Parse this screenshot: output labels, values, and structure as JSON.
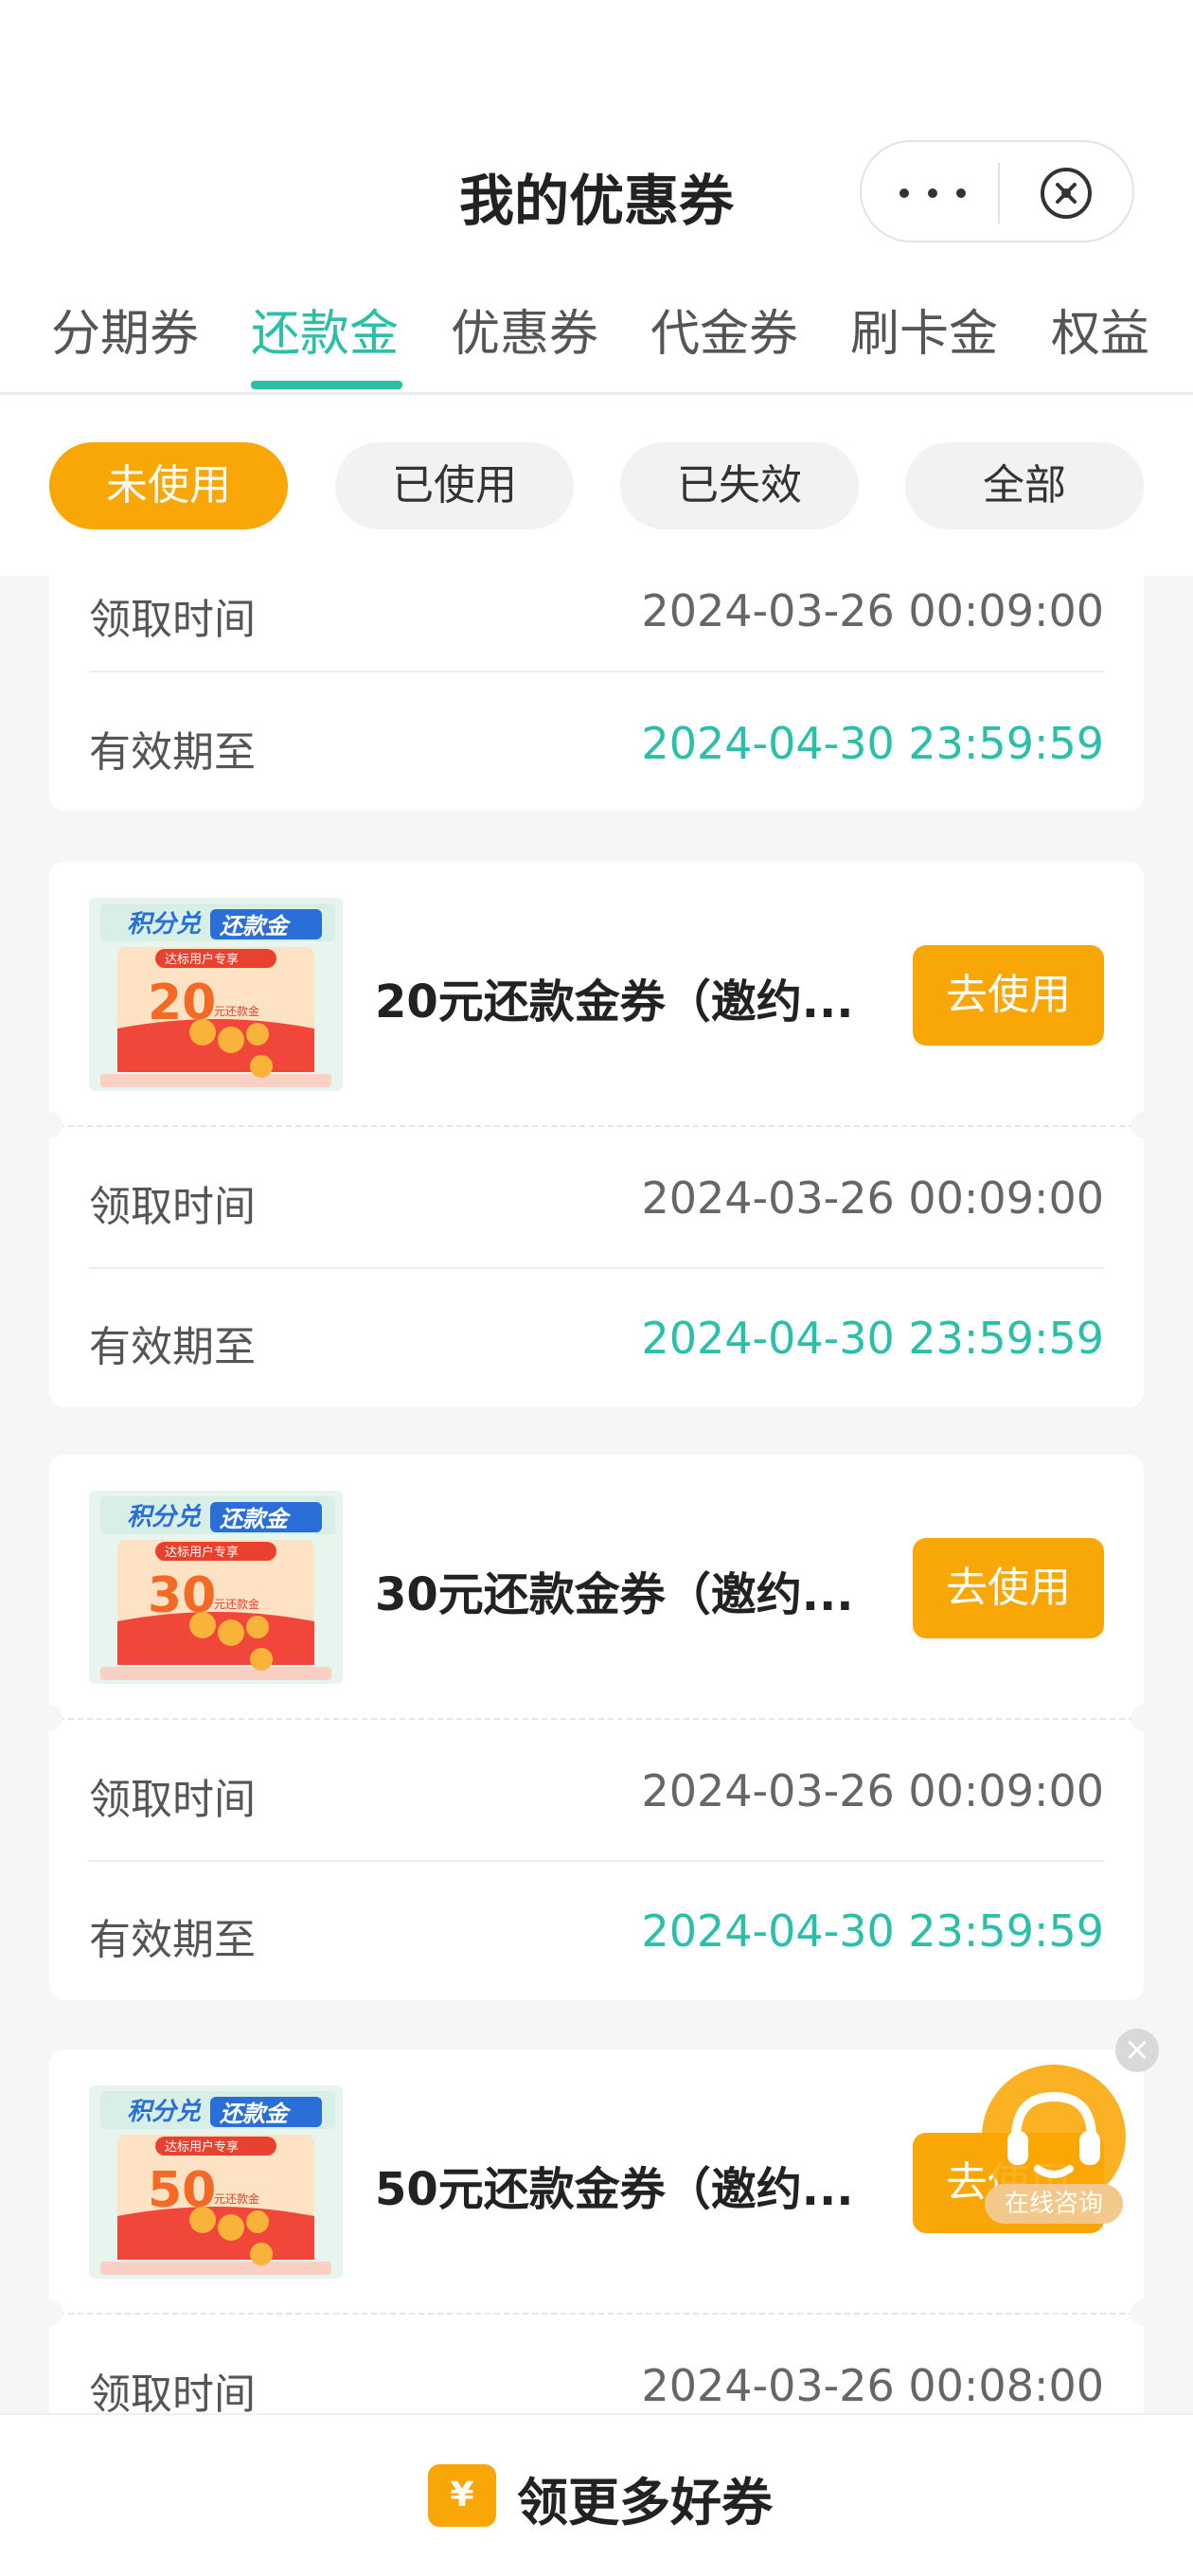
{
  "header": {
    "title": "我的优惠券"
  },
  "tabs": [
    {
      "label": "分期券",
      "active": false
    },
    {
      "label": "还款金",
      "active": true
    },
    {
      "label": "优惠券",
      "active": false
    },
    {
      "label": "代金券",
      "active": false
    },
    {
      "label": "刷卡金",
      "active": false
    },
    {
      "label": "权益",
      "active": false
    }
  ],
  "filters": [
    {
      "label": "未使用",
      "active": true
    },
    {
      "label": "已使用",
      "active": false
    },
    {
      "label": "已失效",
      "active": false
    },
    {
      "label": "全部",
      "active": false
    }
  ],
  "labels": {
    "received": "领取时间",
    "expires": "有效期至",
    "use_button": "去使用"
  },
  "coupons": [
    {
      "name": "",
      "received": "2024-03-26 00:09:00",
      "expires": "2024-04-30 23:59:59"
    },
    {
      "name": "20元还款金券（邀约...",
      "amount": "20",
      "received": "2024-03-26 00:09:00",
      "expires": "2024-04-30 23:59:59"
    },
    {
      "name": "30元还款金券（邀约...",
      "amount": "30",
      "received": "2024-03-26 00:09:00",
      "expires": "2024-04-30 23:59:59"
    },
    {
      "name": "50元还款金券（邀约...",
      "amount": "50",
      "received": "2024-03-26 00:08:00",
      "expires": ""
    }
  ],
  "thumb": {
    "banner_a": "积分兑",
    "banner_b": "还款金",
    "subtitle": "达标用户专享",
    "unit": "元还款金"
  },
  "service": {
    "label": "在线咨询"
  },
  "bottom_bar": {
    "label": "领更多好券",
    "icon": "¥"
  },
  "colors": {
    "accent": "#2bbfa8",
    "orange": "#f9a706"
  }
}
